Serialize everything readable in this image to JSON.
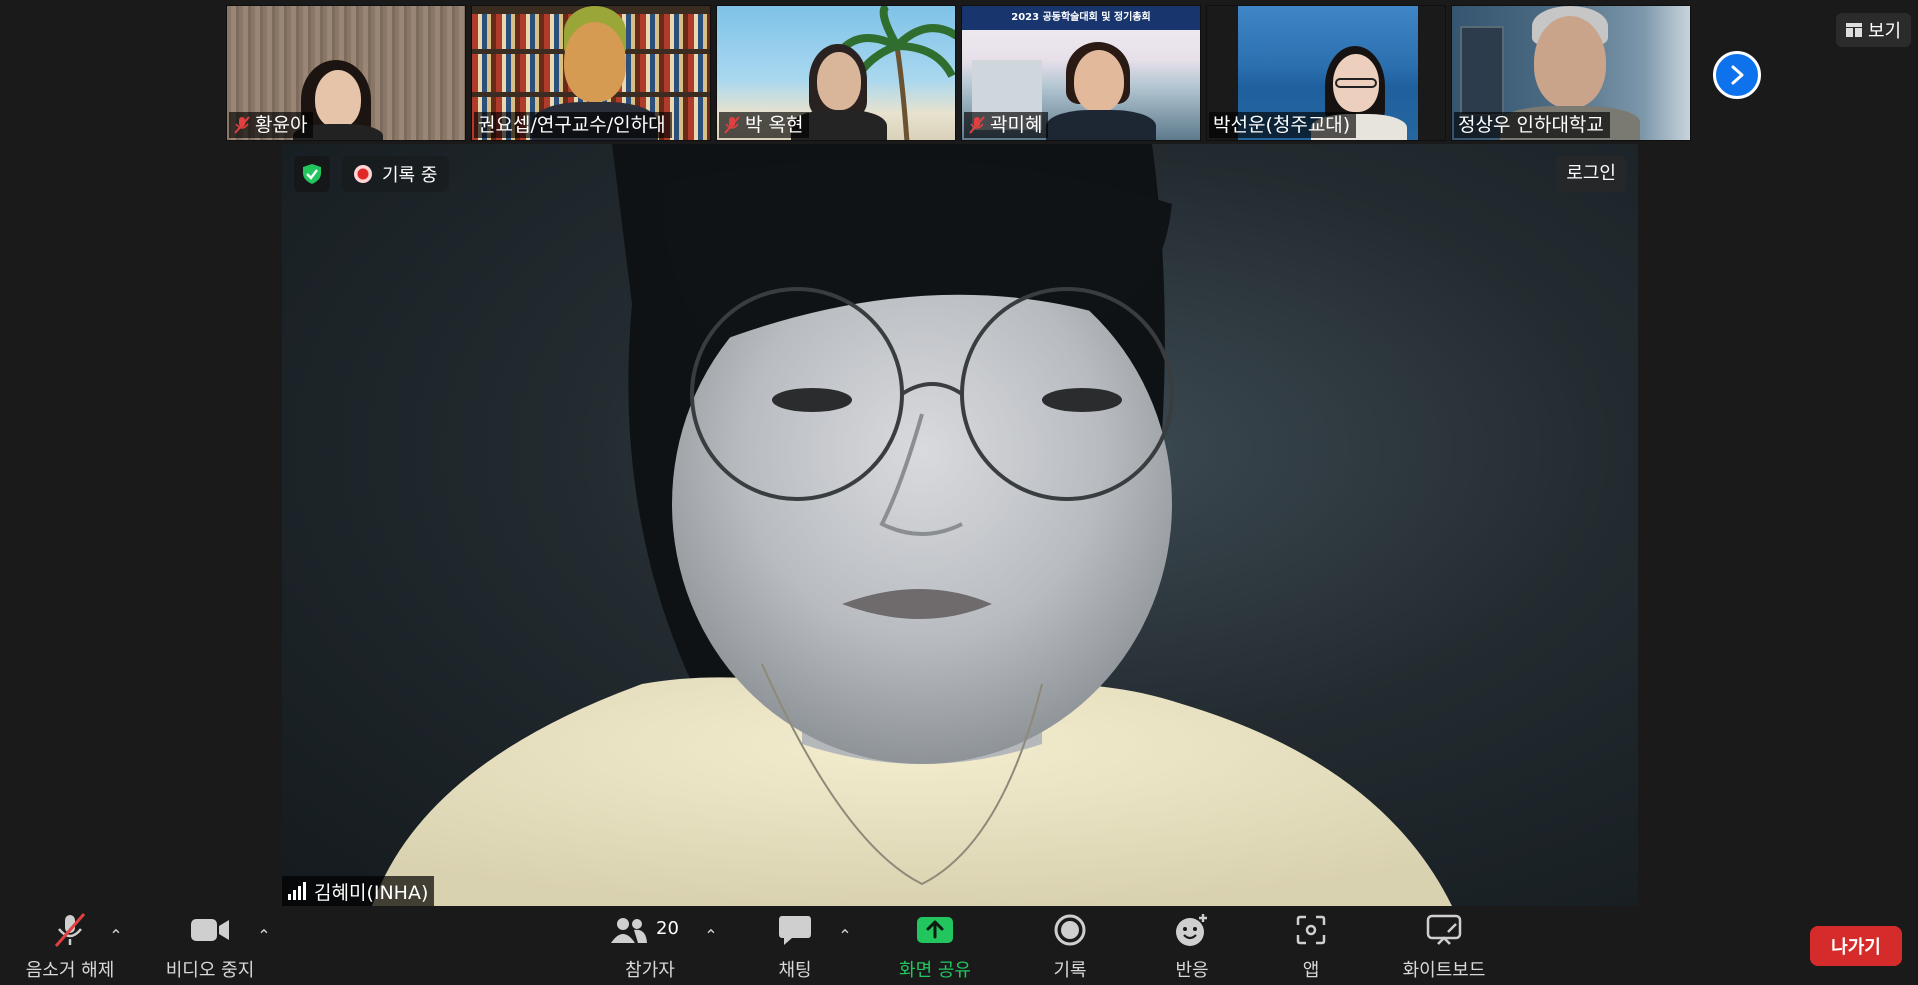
{
  "thumbnails": [
    {
      "name": "황윤아",
      "muted": true,
      "bg": "#8a7a6a"
    },
    {
      "name": "권요셉/연구교수/인하대",
      "muted": false,
      "bg": "#5a4a3a"
    },
    {
      "name": "박 옥현",
      "muted": true,
      "bg": "#7ab6d8"
    },
    {
      "name": "곽미혜",
      "muted": true,
      "bg": "#9db5cc"
    },
    {
      "name": "박선운(청주교대)",
      "muted": false,
      "bg": "#2e6ea8"
    },
    {
      "name": "정상우 인하대학교",
      "muted": false,
      "bg": "#4e6a80"
    }
  ],
  "thumb_banner": {
    "line1": "2023 공동학술대회 및 정기총회"
  },
  "top_right": {
    "view_label": "보기"
  },
  "main": {
    "recording_label": "기록 중",
    "login_label": "로그인",
    "speaker_name": "김혜미(INHA)"
  },
  "toolbar": {
    "mute_label": "음소거 해제",
    "video_label": "비디오 중지",
    "participants_label": "참가자",
    "participants_count": "20",
    "chat_label": "채팅",
    "share_label": "화면 공유",
    "record_label": "기록",
    "reactions_label": "반응",
    "apps_label": "앱",
    "whiteboard_label": "화이트보드",
    "leave_label": "나가기"
  },
  "colors": {
    "background": "#1a1a1a",
    "share_green": "#22c55e",
    "leave_red": "#d62b2b",
    "accent_blue": "#0e72ed",
    "shield_green": "#22c55e"
  },
  "icons": [
    "muted-mic-icon",
    "video-camera-icon",
    "participants-icon",
    "chat-icon",
    "share-screen-icon",
    "record-icon",
    "reactions-icon",
    "apps-icon",
    "whiteboard-icon",
    "shield-icon",
    "chevron-right-icon",
    "view-grid-icon",
    "signal-icon"
  ]
}
